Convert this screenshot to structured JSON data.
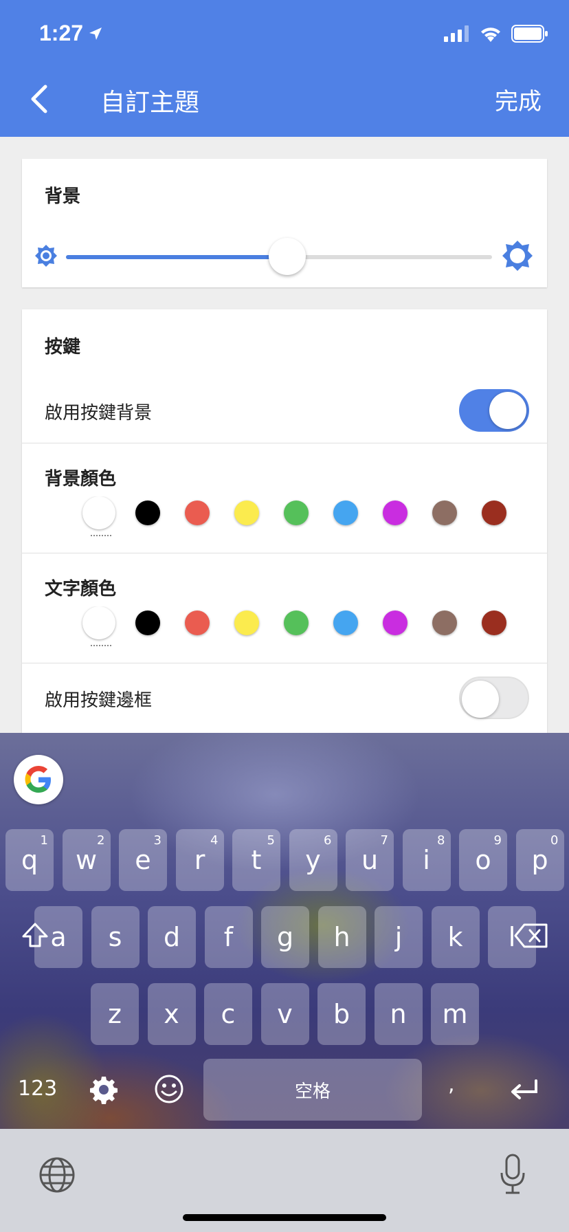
{
  "status_bar": {
    "time": "1:27"
  },
  "header": {
    "title": "自訂主題",
    "done_label": "完成"
  },
  "background_section": {
    "title": "背景",
    "brightness_level": 0.52
  },
  "keys_section": {
    "title": "按鍵",
    "enable_key_background_label": "啟用按鍵背景",
    "enable_key_background_on": true,
    "background_color_label": "背景顏色",
    "text_color_label": "文字顏色",
    "enable_key_border_label": "啟用按鍵邊框",
    "enable_key_border_on": false,
    "accent_color": "#5081e6"
  },
  "color_palette": [
    "#ffffff",
    "#000000",
    "#ea5c50",
    "#fbeb4e",
    "#55c05a",
    "#45a5f0",
    "#c92de0",
    "#8d6e63",
    "#9a2e1f",
    "#e58a2c"
  ],
  "keyboard": {
    "row1": [
      {
        "char": "q",
        "hint": "1"
      },
      {
        "char": "w",
        "hint": "2"
      },
      {
        "char": "e",
        "hint": "3"
      },
      {
        "char": "r",
        "hint": "4"
      },
      {
        "char": "t",
        "hint": "5"
      },
      {
        "char": "y",
        "hint": "6"
      },
      {
        "char": "u",
        "hint": "7"
      },
      {
        "char": "i",
        "hint": "8"
      },
      {
        "char": "o",
        "hint": "9"
      },
      {
        "char": "p",
        "hint": "0"
      }
    ],
    "row2": [
      "a",
      "s",
      "d",
      "f",
      "g",
      "h",
      "j",
      "k",
      "l"
    ],
    "row3": [
      "z",
      "x",
      "c",
      "v",
      "b",
      "n",
      "m"
    ],
    "numbers_label": "123",
    "space_label": "空格",
    "comma_label": ","
  }
}
